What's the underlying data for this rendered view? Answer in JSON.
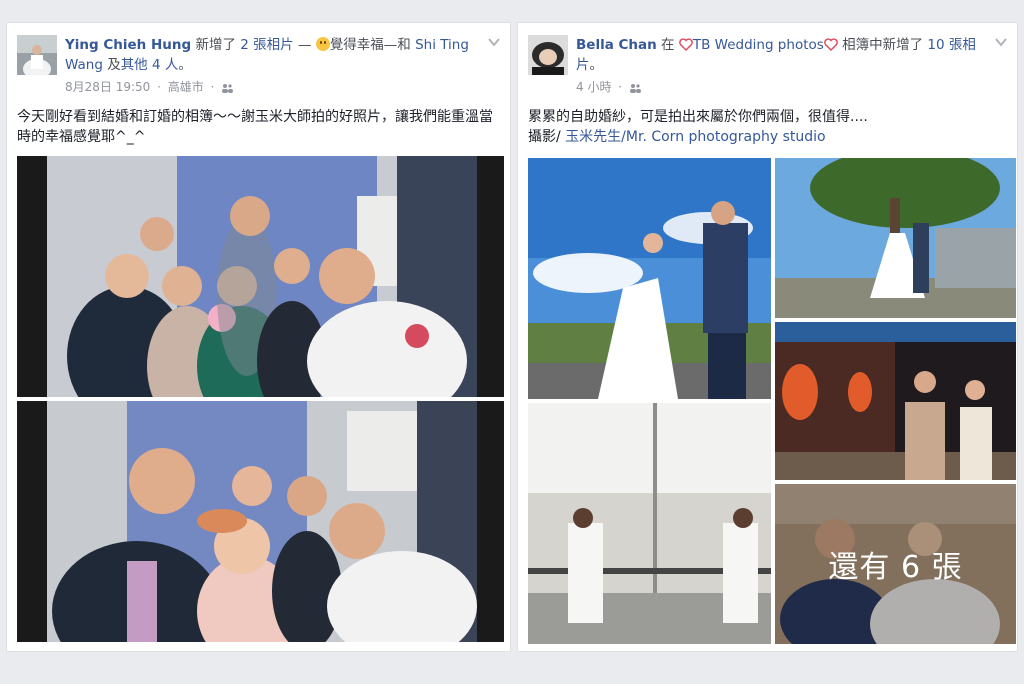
{
  "post1": {
    "author": "Ying Chieh Hung",
    "action": "新增了",
    "photo_count": "2 張相片",
    "dash": "—",
    "feeling": "覺得幸福",
    "with_prefix": "—和",
    "tag1": "Shi Ting Wang",
    "and": "及",
    "others": "其他 4 人",
    "period": "。",
    "date": "8月28日 19:50",
    "dot": "·",
    "location": "高雄市",
    "text": "今天剛好看到結婚和訂婚的相簿～～謝玉米大師拍的好照片，讓我們能重溫當時的幸福感覺耶^_^",
    "photos": [
      "group-selfie-photo-1",
      "group-selfie-photo-2"
    ]
  },
  "post2": {
    "author": "Bella Chan",
    "in": "在",
    "album": "TB Wedding photos",
    "album_suffix": "相簿中新增了",
    "photo_count": "10 張相片",
    "period": "。",
    "time": "4 小時",
    "dot": "·",
    "text_line1": "累累的自助婚紗，可是拍出來屬於你們兩個，很值得....",
    "text_line2_prefix": "攝影/ ",
    "text_line2_link": "玉米先生",
    "text_line2_suffix": "/Mr. Corn photography studio",
    "more_photos": "還有 6 張"
  },
  "colors": {
    "link": "#365899",
    "text": "#1d2129",
    "meta": "#90949c",
    "background": "#e9ebee"
  }
}
